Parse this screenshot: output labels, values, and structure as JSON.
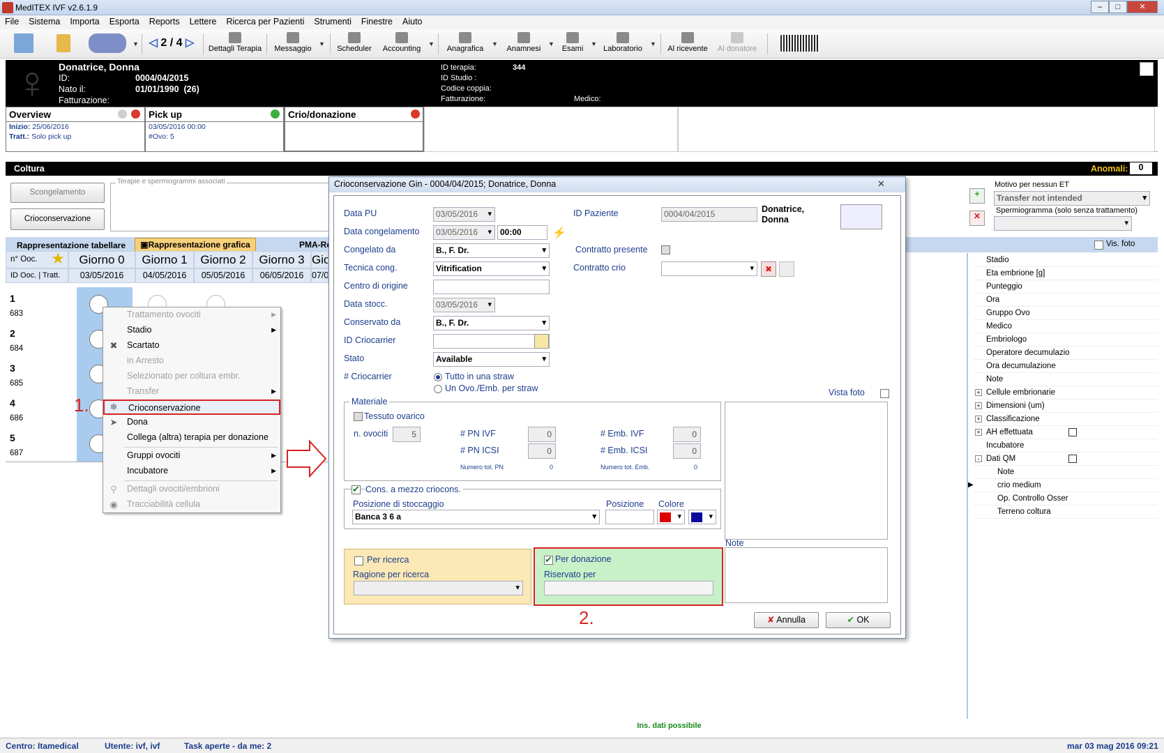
{
  "window": {
    "title": "MedITEX IVF v2.6.1.9"
  },
  "menu": [
    "File",
    "Sistema",
    "Importa",
    "Esporta",
    "Reports",
    "Lettere",
    "Ricerca per Pazienti",
    "Strumenti",
    "Finestre",
    "Aiuto"
  ],
  "toolbar": {
    "page": "2 / 4",
    "items": [
      "Dettagli Terapia",
      "Messaggio",
      "Scheduler",
      "Accounting",
      "Anagrafica",
      "Anamnesi",
      "Esami",
      "Laboratorio",
      "Al ricevente",
      "Al donatore"
    ]
  },
  "patient": {
    "name": "Donatrice, Donna",
    "id_label": "ID:",
    "id": "0004/04/2015",
    "born_label": "Nato il:",
    "born": "01/01/1990",
    "age": "(26)",
    "billing_label": "Fatturazione:",
    "therapy_id_label": "ID terapia:",
    "therapy_id": "344",
    "study_label": "ID Studio :",
    "couple_label": "Codice coppia:",
    "billing2_label": "Fatturazione:",
    "doctor_label": "Medico:"
  },
  "ptabs": {
    "overview": {
      "title": "Overview",
      "start_label": "Inizio:",
      "start": "25/06/2016",
      "tratt_label": "Tratt.:",
      "tratt": "Solo pick up"
    },
    "pickup": {
      "title": "Pick up",
      "date": "03/05/2016 00:00",
      "ovo_label": "#Ovo:",
      "ovo": "5"
    },
    "crio": {
      "title": "Crio/donazione"
    }
  },
  "coltura": {
    "title": "Coltura",
    "anomali_label": "Anomali:",
    "anomali": "0",
    "btn_scongelamento": "Scongelamento",
    "btn_crioconservazione": "Crioconservazione",
    "assoc_legend": "Terapie e spermiogrammi associati",
    "motivo_label": "Motivo per nessun ET",
    "motivo_value": "Transfer not intended",
    "sperm_label": "Spermiogramma (solo senza trattamento)",
    "vis_foto": "Vis. foto",
    "view_tabs": [
      "Rappresentazione tabellare",
      "Rappresentazione grafica",
      "PMA-Re"
    ]
  },
  "grid": {
    "col0_h": "n° Ooc.",
    "col0_d": "ID Ooc. | Tratt.",
    "days": [
      "Giorno 0",
      "Giorno 1",
      "Giorno 2",
      "Giorno 3",
      "Gio"
    ],
    "dates": [
      "03/05/2016",
      "04/05/2016",
      "05/05/2016",
      "06/05/2016",
      "07/0"
    ],
    "rows": [
      {
        "n": "1",
        "id": "683"
      },
      {
        "n": "2",
        "id": "684"
      },
      {
        "n": "3",
        "id": "685"
      },
      {
        "n": "4",
        "id": "686"
      },
      {
        "n": "5",
        "id": "687"
      }
    ]
  },
  "context_menu": {
    "items": [
      "Trattamento ovociti",
      "Stadio",
      "Scartato",
      "in Arresto",
      "Selezionato per coltura embr.",
      "Transfer",
      "Crioconservazione",
      "Dona",
      "Collega (altra) terapia per donazione",
      "Gruppi ovociti",
      "Incubatore",
      "Dettagli ovociti/embrioni",
      "Tracciabilità cellula"
    ]
  },
  "annotations": {
    "step1": "1.",
    "step2": "2."
  },
  "dialog": {
    "title": "Crioconservazione Gin  - 0004/04/2015; Donatrice, Donna",
    "data_pu_label": "Data PU",
    "data_pu": "03/05/2016",
    "data_cong_label": "Data congelamento",
    "data_cong": "03/05/2016",
    "ora_cong": "00:00",
    "congelato_label": "Congelato da",
    "congelato": "B., F. Dr.",
    "tecnica_label": "Tecnica cong.",
    "tecnica": "Vitrification",
    "centro_label": "Centro di origine",
    "stocc_label": "Data stocc.",
    "stocc": "03/05/2016",
    "conservato_label": "Conservato da",
    "conservato": "B., F. Dr.",
    "criocarrier_label": "ID Criocarrier",
    "stato_label": "Stato",
    "stato": "Available",
    "ncrio_label": "# Criocarrier",
    "radio1": "Tutto in una straw",
    "radio2": "Un Ovo./Emb. per straw",
    "idpaz_label": "ID Paziente",
    "idpaz": "0004/04/2015",
    "paz_name": "Donatrice, Donna",
    "contratto_presente": "Contratto presente",
    "contratto_crio": "Contratto crio",
    "vista_foto": "Vista foto",
    "materiale": "Materiale",
    "tessuto": "Tessuto ovarico",
    "novociti_label": "n. ovociti",
    "novociti": "5",
    "pn_ivf_label": "# PN IVF",
    "pn_ivf": "0",
    "pn_icsi_label": "# PN ICSI",
    "pn_icsi": "0",
    "emb_ivf_label": "# Emb. IVF",
    "emb_ivf": "0",
    "emb_icsi_label": "# Emb. ICSI",
    "emb_icsi": "0",
    "tot_pn_label": "Numero tot. PN",
    "tot_pn": "0",
    "tot_emb_label": "Numero tot. Emb.",
    "tot_emb": "0",
    "cons_mezzo": "Cons. a mezzo criocons.",
    "pos_stocc_label": "Posizione di stoccaggio",
    "pos_stocc": "Banca 3 6 a",
    "posizione_label": "Posizione",
    "colore_label": "Colore",
    "color1": "#e00000",
    "color2": "#0a0a9a",
    "note_label": "Note",
    "ricerca": "Per ricerca",
    "ragione": "Ragione per ricerca",
    "donazione": "Per donazione",
    "riservato": "Riservato per",
    "annulla": "Annulla",
    "ok": "OK"
  },
  "right_panel": {
    "items": [
      "Stadio",
      "Eta embrione [g]",
      "Punteggio",
      "Ora",
      "Gruppo Ovo",
      "Medico",
      "Embriologo",
      "Operatore decumulazio",
      "Ora decumulazione",
      "Note",
      "Cellule embrionarie",
      "Dimensioni (um)",
      "Classificazione",
      "AH effettuata",
      "Incubatore",
      "Dati QM",
      "Note",
      "crio medium",
      "Op. Controllo Osser",
      "Terreno coltura"
    ]
  },
  "ins_dati": "Ins. dati possibile",
  "status": {
    "centro": "Centro: Itamedical",
    "utente": "Utente: ivf, ivf",
    "task": "Task aperte - da me: 2",
    "datetime": "mar 03 mag 2016 09:21"
  }
}
